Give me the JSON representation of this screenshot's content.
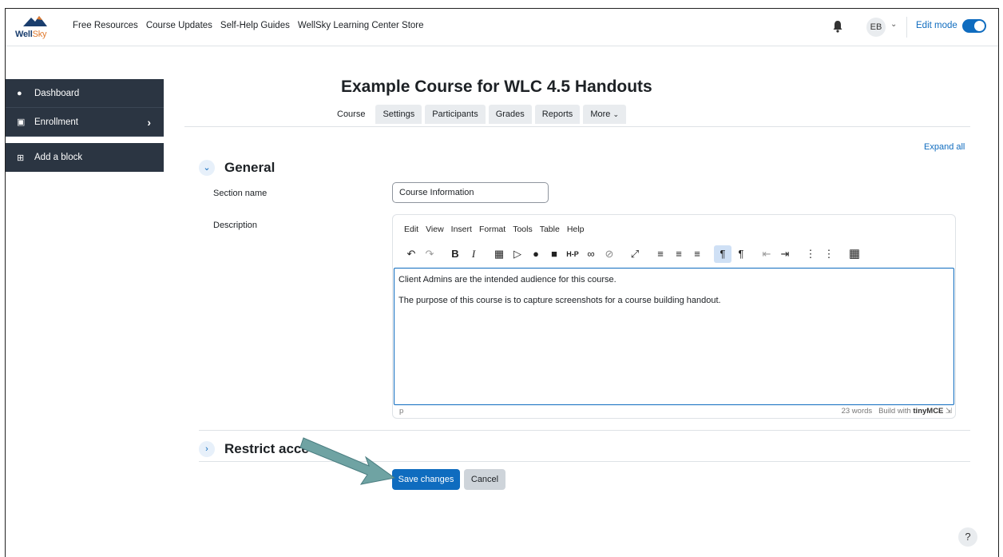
{
  "nav": {
    "logo_text_main": "Well",
    "logo_text_accent": "Sky",
    "links": [
      "Free Resources",
      "Course Updates",
      "Self-Help Guides",
      "WellSky Learning Center Store"
    ],
    "avatar_initials": "EB",
    "edit_mode_label": "Edit mode"
  },
  "drawer": {
    "items": [
      {
        "label": "Dashboard",
        "icon": "dashboard-icon"
      },
      {
        "label": "Enrollment",
        "icon": "institution-icon"
      }
    ],
    "add_block_label": "Add a block"
  },
  "course": {
    "title": "Example Course for WLC 4.5 Handouts",
    "tabs": [
      "Course",
      "Settings",
      "Participants",
      "Grades",
      "Reports",
      "More"
    ]
  },
  "form": {
    "expand_all": "Expand all",
    "general_title": "General",
    "section_name_label": "Section name",
    "section_name_value": "Course Information",
    "description_label": "Description",
    "restrict_title": "Restrict acce"
  },
  "editor": {
    "menu": [
      "Edit",
      "View",
      "Insert",
      "Format",
      "Tools",
      "Table",
      "Help"
    ],
    "paragraph1": "Client Admins are the intended audience for this course.",
    "paragraph2": "The purpose of this course is to capture screenshots for a course building handout.",
    "path": "p",
    "word_count": "23 words",
    "build_with": "Build with",
    "brand": "tinyMCE"
  },
  "buttons": {
    "save": "Save changes",
    "cancel": "Cancel",
    "help": "?"
  },
  "colors": {
    "accent": "#0f6cbf",
    "drawer_bg": "#2b3542",
    "annotation_arrow": "#6fa3a3"
  }
}
